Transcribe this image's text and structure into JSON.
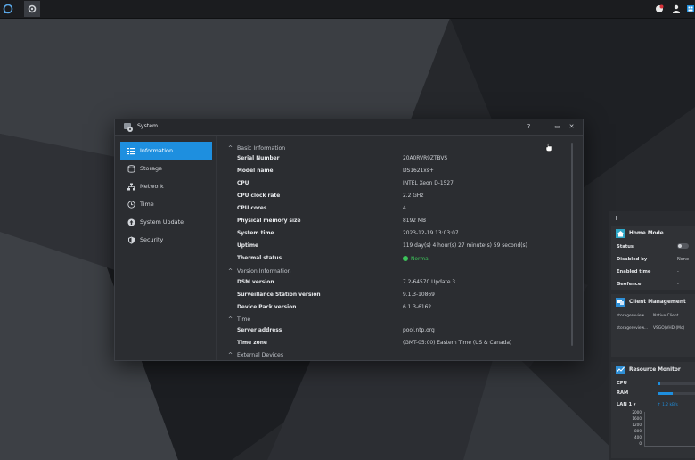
{
  "window": {
    "title": "System",
    "controls": [
      "?",
      "–",
      "▭",
      "✕"
    ]
  },
  "sidebar": {
    "items": [
      {
        "label": "Information",
        "icon": "info-list-icon",
        "active": true
      },
      {
        "label": "Storage",
        "icon": "storage-icon",
        "active": false
      },
      {
        "label": "Network",
        "icon": "network-icon",
        "active": false
      },
      {
        "label": "Time",
        "icon": "clock-icon",
        "active": false
      },
      {
        "label": "System Update",
        "icon": "update-icon",
        "active": false
      },
      {
        "label": "Security",
        "icon": "shield-icon",
        "active": false
      }
    ]
  },
  "content": {
    "sections": [
      {
        "title": "Basic Information"
      },
      {
        "title": "Version Information"
      },
      {
        "title": "Time"
      },
      {
        "title": "External Devices"
      }
    ],
    "basic": [
      {
        "label": "Serial Number",
        "value": "20A0RVR9ZTBVS"
      },
      {
        "label": "Model name",
        "value": "DS1621xs+"
      },
      {
        "label": "CPU",
        "value": "INTEL Xeon D-1527"
      },
      {
        "label": "CPU clock rate",
        "value": "2.2 GHz"
      },
      {
        "label": "CPU cores",
        "value": "4"
      },
      {
        "label": "Physical memory size",
        "value": "8192 MB"
      },
      {
        "label": "System time",
        "value": "2023-12-19 13:03:07"
      },
      {
        "label": "Uptime",
        "value": "119 day(s) 4 hour(s) 27 minute(s) 59 second(s)"
      },
      {
        "label": "Thermal status",
        "value": "Normal"
      }
    ],
    "version": [
      {
        "label": "DSM version",
        "value": "7.2-64570 Update 3"
      },
      {
        "label": "Surveillance Station version",
        "value": "9.1.3-10869"
      },
      {
        "label": "Device Pack version",
        "value": "6.1.3-6162"
      }
    ],
    "time": [
      {
        "label": "Server address",
        "value": "pool.ntp.org"
      },
      {
        "label": "Time zone",
        "value": "(GMT-05:00) Eastern Time (US & Canada)"
      }
    ]
  },
  "widgets": {
    "plus": "+",
    "home_mode": {
      "title": "Home Mode",
      "rows": [
        {
          "label": "Status",
          "value": ""
        },
        {
          "label": "Disabled by",
          "value": "None"
        },
        {
          "label": "Enabled time",
          "value": "-"
        },
        {
          "label": "Geofence",
          "value": "-"
        }
      ]
    },
    "client_management": {
      "title": "Client Management",
      "rows": [
        {
          "name": "storagereview...",
          "client": "Native Client"
        },
        {
          "name": "storagereview...",
          "client": "VSGO(VHD (Mo)"
        }
      ]
    },
    "resource_monitor": {
      "title": "Resource Monitor",
      "cpu_label": "CPU",
      "ram_label": "RAM",
      "lan_label": "LAN 1 ▾",
      "lan_rate": "↑ 1.2 kB/s",
      "cpu_fraction": 0.08,
      "ram_fraction": 0.4,
      "axis": [
        "2000",
        "1600",
        "1200",
        "800",
        "400",
        "0"
      ]
    }
  },
  "colors": {
    "accent": "#1e8fdf",
    "normal": "#3cc35a"
  }
}
